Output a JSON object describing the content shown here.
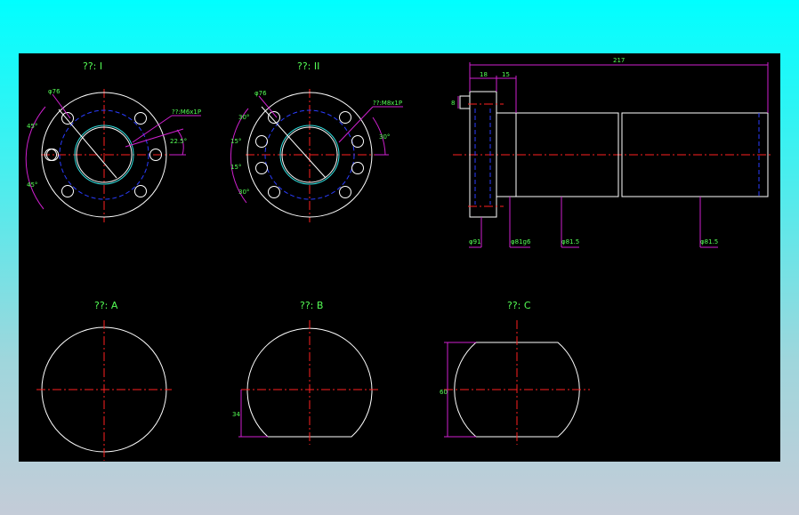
{
  "views": {
    "view1_title": "??: I",
    "view2_title": "??: II",
    "viewA_title": "??: A",
    "viewB_title": "??: B",
    "viewC_title": "??: C"
  },
  "dims": {
    "v1_dia": "φ76",
    "v1_thread": "??:M6x1P",
    "v1_ang_top": "45°",
    "v1_ang_bot": "45°",
    "v1_ang_right": "22.5°",
    "v2_dia": "φ76",
    "v2_thread": "??:M8x1P",
    "v2_ang_30a": "30°",
    "v2_ang_15a": "15°",
    "v2_ang_15b": "15°",
    "v2_ang_30b": "30°",
    "v2_ang_right": "30°",
    "side_217": "217",
    "side_18": "18",
    "side_15": "15",
    "side_8": "8",
    "side_d91": "φ91",
    "side_d81g6": "φ81g6",
    "side_d81a": "φ81.5",
    "side_d81b": "φ81.5",
    "vB_34": "34",
    "vC_60": "60"
  }
}
